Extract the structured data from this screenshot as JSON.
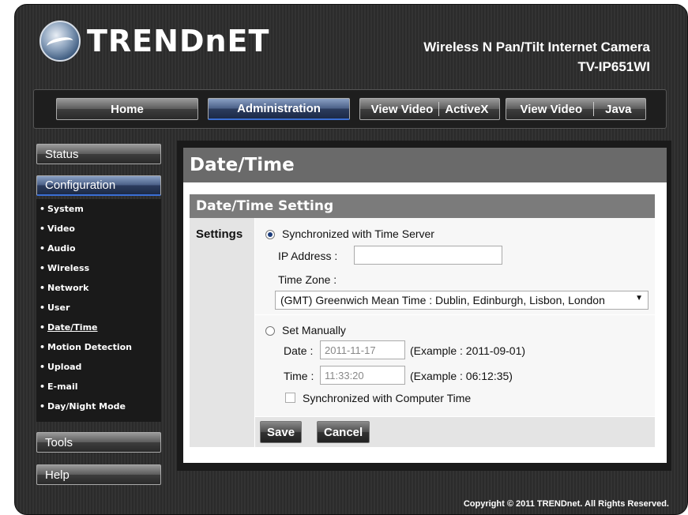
{
  "brand": {
    "logo_text": "TRENDnET"
  },
  "product": {
    "line1": "Wireless N Pan/Tilt Internet Camera",
    "model": "TV-IP651WI"
  },
  "nav": {
    "home": "Home",
    "administration": "Administration",
    "view_video_activex_a": "View Video",
    "view_video_activex_b": "ActiveX",
    "view_video_java_a": "View Video",
    "view_video_java_b": "Java"
  },
  "sidebar": {
    "status": "Status",
    "configuration": "Configuration",
    "submenu": [
      "System",
      "Video",
      "Audio",
      "Wireless",
      "Network",
      "User",
      "Date/Time",
      "Motion Detection",
      "Upload",
      "E-mail",
      "Day/Night Mode"
    ],
    "tools": "Tools",
    "help": "Help"
  },
  "page": {
    "title": "Date/Time"
  },
  "section": {
    "heading": "Date/Time Setting",
    "settings_label": "Settings",
    "sync_label": "Synchronized with Time Server",
    "ip_label": "IP Address  :",
    "ip_value": "",
    "tz_label": "Time Zone  :",
    "tz_value": "(GMT) Greenwich Mean Time : Dublin, Edinburgh, Lisbon, London",
    "manual_label": "Set Manually",
    "date_label": "Date  :",
    "date_value": "2011-11-17",
    "date_example": "(Example : 2011-09-01)",
    "time_label": "Time  :",
    "time_value": "11:33:20",
    "time_example": "(Example : 06:12:35)",
    "pc_sync_label": "Synchronized with Computer Time",
    "sync_selected": true,
    "pc_sync_checked": false
  },
  "buttons": {
    "save": "Save",
    "cancel": "Cancel"
  },
  "footer": {
    "copyright": "Copyright © 2011 TRENDnet. All Rights Reserved."
  },
  "colors": {
    "frame": "#2b2b2b",
    "active_accent": "#3b6fd4",
    "panel_header": "#7b7b7b"
  }
}
